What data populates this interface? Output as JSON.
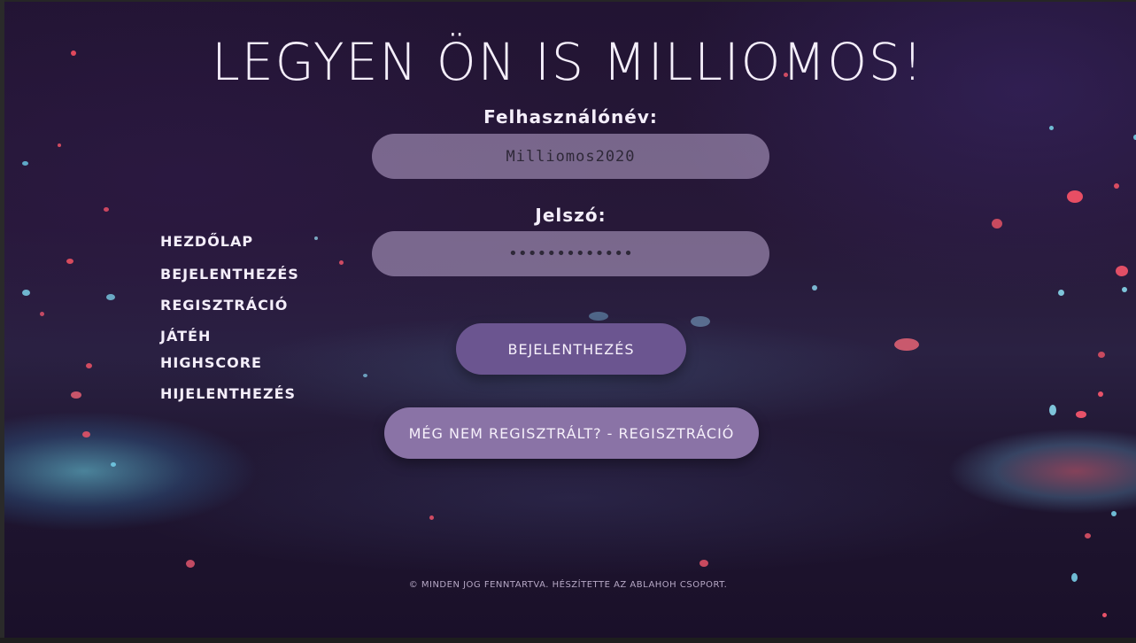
{
  "page": {
    "title": "Legyen Ön is Milliomos!"
  },
  "login": {
    "username_label": "Felhasználónév:",
    "username_value": "Milliomos2020",
    "password_label": "Jelszó:",
    "password_value": "•••••••••••••",
    "login_button": "Bejelenthezés",
    "register_button": "Még nem regisztrált? - Regisztráció"
  },
  "nav": {
    "items": [
      {
        "label": "Hezdőlap"
      },
      {
        "label": "Bejelenthezés"
      },
      {
        "label": "Regisztráció"
      },
      {
        "label": "Játéh"
      },
      {
        "label": "Highscore"
      },
      {
        "label": "Hijelenthezés"
      }
    ]
  },
  "footer": {
    "copyright_symbol": "©",
    "text": "Minden jog fenntartva. Hészítette az Ablahoh csoport."
  },
  "colors": {
    "background": "#241634",
    "input_fill": "#b9a7cc",
    "login_button": "#6b5590",
    "register_button": "#8a73a6",
    "text": "#f4eefa"
  }
}
